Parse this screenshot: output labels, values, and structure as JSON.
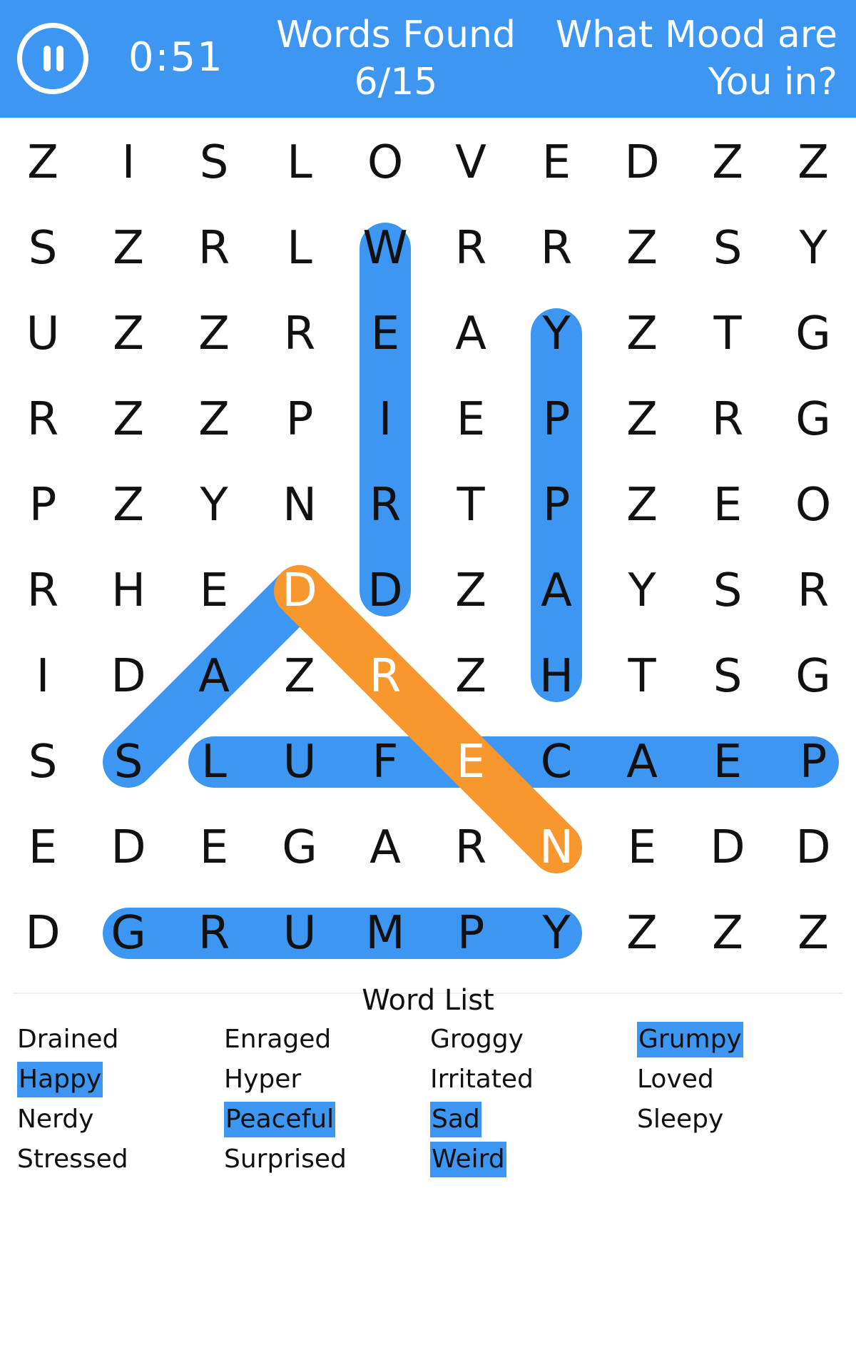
{
  "header": {
    "timer": "0:51",
    "words_found_label": "Words Found",
    "words_found_count": "6/15",
    "puzzle_title_line1": "What Mood are",
    "puzzle_title_line2": "You in?"
  },
  "colors": {
    "header_bg": "#3d96f2",
    "found_highlight": "#3d96f2",
    "current_highlight": "#f7972e",
    "letter": "#111111"
  },
  "grid": {
    "rows": [
      [
        "Z",
        "I",
        "S",
        "L",
        "O",
        "V",
        "E",
        "D",
        "Z",
        "Z"
      ],
      [
        "S",
        "Z",
        "R",
        "L",
        "W",
        "R",
        "R",
        "Z",
        "S",
        "Y"
      ],
      [
        "U",
        "Z",
        "Z",
        "R",
        "E",
        "A",
        "Y",
        "Z",
        "T",
        "G"
      ],
      [
        "R",
        "Z",
        "Z",
        "P",
        "I",
        "E",
        "P",
        "Z",
        "R",
        "G"
      ],
      [
        "P",
        "Z",
        "Y",
        "N",
        "R",
        "T",
        "P",
        "Z",
        "E",
        "O"
      ],
      [
        "R",
        "H",
        "E",
        "D",
        "D",
        "Z",
        "A",
        "Y",
        "S",
        "R"
      ],
      [
        "I",
        "D",
        "A",
        "Z",
        "R",
        "Z",
        "H",
        "T",
        "S",
        "G"
      ],
      [
        "S",
        "S",
        "L",
        "U",
        "F",
        "E",
        "C",
        "A",
        "E",
        "P"
      ],
      [
        "E",
        "D",
        "E",
        "G",
        "A",
        "R",
        "N",
        "E",
        "D",
        "D"
      ],
      [
        "D",
        "G",
        "R",
        "U",
        "M",
        "P",
        "Y",
        "Z",
        "Z",
        "Z"
      ]
    ],
    "found_words": [
      {
        "word": "Weird",
        "start": [
          1,
          4
        ],
        "end": [
          5,
          4
        ]
      },
      {
        "word": "Happy",
        "start": [
          6,
          6
        ],
        "end": [
          2,
          6
        ]
      },
      {
        "word": "Sad",
        "start": [
          7,
          1
        ],
        "end": [
          5,
          3
        ]
      },
      {
        "word": "Peaceful",
        "start": [
          7,
          9
        ],
        "end": [
          7,
          2
        ]
      },
      {
        "word": "Grumpy",
        "start": [
          9,
          1
        ],
        "end": [
          9,
          6
        ]
      }
    ],
    "current_selection": {
      "start": [
        5,
        3
      ],
      "end": [
        8,
        6
      ]
    }
  },
  "word_list": {
    "title": "Word List",
    "columns": [
      [
        {
          "text": "Drained",
          "found": false
        },
        {
          "text": "Happy",
          "found": true
        },
        {
          "text": "Nerdy",
          "found": false
        },
        {
          "text": "Stressed",
          "found": false
        }
      ],
      [
        {
          "text": "Enraged",
          "found": false
        },
        {
          "text": "Hyper",
          "found": false
        },
        {
          "text": "Peaceful",
          "found": true
        },
        {
          "text": "Surprised",
          "found": false
        }
      ],
      [
        {
          "text": "Groggy",
          "found": false
        },
        {
          "text": "Irritated",
          "found": false
        },
        {
          "text": "Sad",
          "found": true
        },
        {
          "text": "Weird",
          "found": true
        }
      ],
      [
        {
          "text": "Grumpy",
          "found": true
        },
        {
          "text": "Loved",
          "found": false
        },
        {
          "text": "Sleepy",
          "found": false
        }
      ]
    ]
  }
}
